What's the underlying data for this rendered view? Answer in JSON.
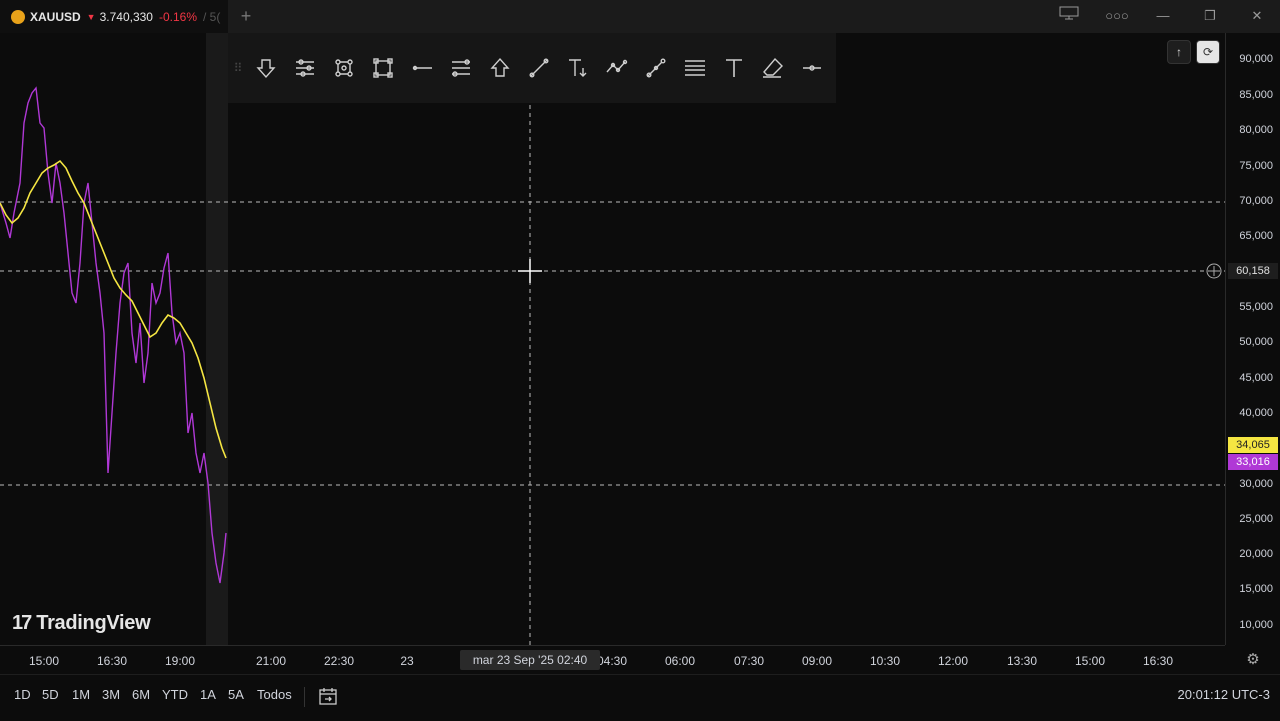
{
  "tab": {
    "symbol": "XAUUSD",
    "direction_glyph": "▼",
    "price": "3.740,330",
    "change": "-0.16%",
    "separator": "/ 5("
  },
  "window_controls": [
    "layout-icon",
    "more-icon",
    "minimize-icon",
    "restore-icon",
    "close-icon"
  ],
  "toolbar": {
    "tools": [
      "arrow-down-icon",
      "settings-lines-icon",
      "nodes-icon",
      "rectangle-icon",
      "horizontal-ray-icon",
      "parallel-channel-icon",
      "arrow-up-icon",
      "trend-line-icon",
      "text-note-icon",
      "path-icon",
      "brush-icon",
      "fib-lines-icon",
      "text-icon",
      "eraser-icon",
      "horizontal-line-icon"
    ]
  },
  "price_axis": {
    "labels": [
      "90,000",
      "85,000",
      "80,000",
      "75,000",
      "70,000",
      "65,000",
      "60,158",
      "55,000",
      "50,000",
      "45,000",
      "40,000",
      "34,065",
      "33,016",
      "30,000",
      "25,000",
      "20,000",
      "15,000",
      "10,000"
    ],
    "crosshair_value": "60,158",
    "tag_yellow": "34,065",
    "tag_purple": "33,016",
    "colors": {
      "yellow": "#f5e642",
      "purple": "#b038d6"
    }
  },
  "time_axis": {
    "labels": [
      "15:00",
      "16:30",
      "19:00",
      "21:00",
      "22:30",
      "23",
      "04:30",
      "06:00",
      "07:30",
      "09:00",
      "10:30",
      "12:00",
      "13:30",
      "15:00",
      "16:30"
    ],
    "crosshair_label": "mar 23 Sep '25   02:40"
  },
  "periods": [
    "1D",
    "5D",
    "1M",
    "3M",
    "6M",
    "YTD",
    "1A",
    "5A",
    "Todos"
  ],
  "clock": "20:01:12 UTC-3",
  "watermark": "TradingView",
  "watermark_logo": "17"
}
